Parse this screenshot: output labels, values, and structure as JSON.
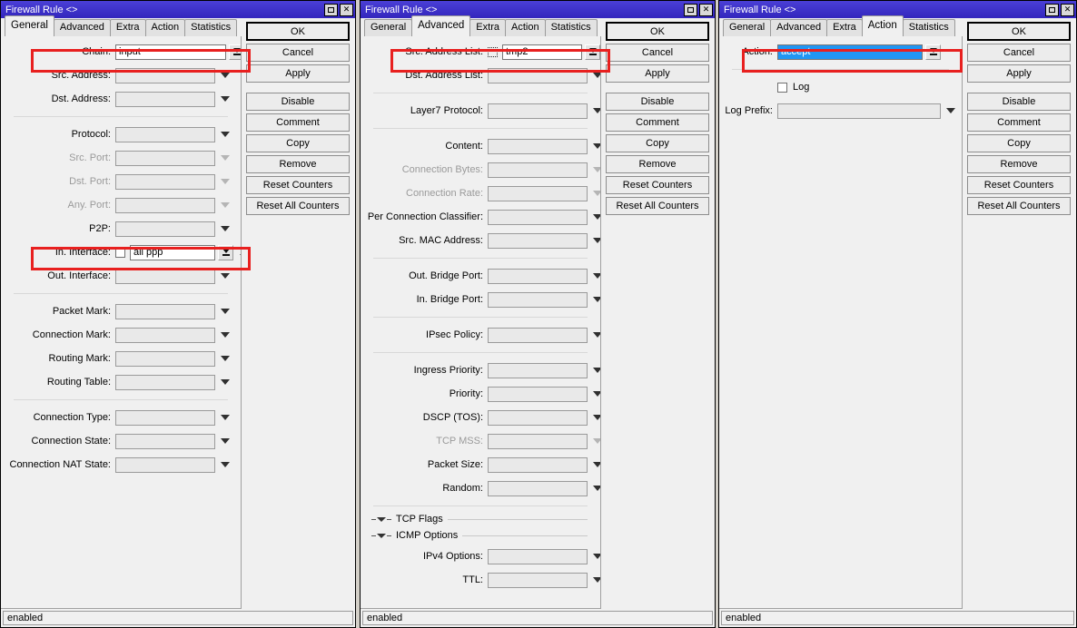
{
  "windows": [
    {
      "title": "Firewall Rule <>",
      "active_tab": "General",
      "tabs": [
        "General",
        "Advanced",
        "Extra",
        "Action",
        "Statistics"
      ],
      "status": "enabled",
      "titlebar_buttons": {
        "maximize": "maximize-icon",
        "close": "✕"
      },
      "rows": [
        {
          "label": "Chain:",
          "value": "input",
          "kind": "dropbtn",
          "dim": false
        },
        {
          "label": "Src. Address:",
          "value": "",
          "kind": "caret",
          "dim": false
        },
        {
          "label": "Dst. Address:",
          "value": "",
          "kind": "caret",
          "dim": false
        },
        {
          "label": "Protocol:",
          "value": "",
          "kind": "caret",
          "dim": false
        },
        {
          "label": "Src. Port:",
          "value": "",
          "kind": "caret",
          "dim": true
        },
        {
          "label": "Dst. Port:",
          "value": "",
          "kind": "caret",
          "dim": true
        },
        {
          "label": "Any. Port:",
          "value": "",
          "kind": "caret",
          "dim": true
        },
        {
          "label": "P2P:",
          "value": "",
          "kind": "caret",
          "dim": false
        },
        {
          "label": "In. Interface:",
          "value": "all ppp",
          "kind": "cb-dropbtn-up",
          "dim": false
        },
        {
          "label": "Out. Interface:",
          "value": "",
          "kind": "caret",
          "dim": false
        },
        {
          "label": "Packet Mark:",
          "value": "",
          "kind": "caret",
          "dim": false
        },
        {
          "label": "Connection Mark:",
          "value": "",
          "kind": "caret",
          "dim": false
        },
        {
          "label": "Routing Mark:",
          "value": "",
          "kind": "caret",
          "dim": false
        },
        {
          "label": "Routing Table:",
          "value": "",
          "kind": "caret",
          "dim": false
        },
        {
          "label": "Connection Type:",
          "value": "",
          "kind": "caret",
          "dim": false
        },
        {
          "label": "Connection State:",
          "value": "",
          "kind": "caret",
          "dim": false
        },
        {
          "label": "Connection NAT State:",
          "value": "",
          "kind": "caret",
          "dim": false
        }
      ],
      "buttons": [
        "OK",
        "Cancel",
        "Apply",
        "Disable",
        "Comment",
        "Copy",
        "Remove",
        "Reset Counters",
        "Reset All Counters"
      ]
    },
    {
      "title": "Firewall Rule <>",
      "active_tab": "Advanced",
      "tabs": [
        "General",
        "Advanced",
        "Extra",
        "Action",
        "Statistics"
      ],
      "status": "enabled",
      "titlebar_buttons": {
        "maximize": "maximize-icon",
        "close": "✕"
      },
      "rows": [
        {
          "label": "Src. Address List:",
          "value": "tmp2",
          "kind": "cbdot-dropbtn-up",
          "dim": false
        },
        {
          "label": "Dst. Address List:",
          "value": "",
          "kind": "caret",
          "dim": false
        },
        {
          "label": "Layer7 Protocol:",
          "value": "",
          "kind": "caret",
          "dim": false
        },
        {
          "label": "Content:",
          "value": "",
          "kind": "caret",
          "dim": false
        },
        {
          "label": "Connection Bytes:",
          "value": "",
          "kind": "caret",
          "dim": true
        },
        {
          "label": "Connection Rate:",
          "value": "",
          "kind": "caret",
          "dim": true
        },
        {
          "label": "Per Connection Classifier:",
          "value": "",
          "kind": "caret",
          "dim": false
        },
        {
          "label": "Src. MAC Address:",
          "value": "",
          "kind": "caret",
          "dim": false
        },
        {
          "label": "Out. Bridge Port:",
          "value": "",
          "kind": "caret",
          "dim": false
        },
        {
          "label": "In. Bridge Port:",
          "value": "",
          "kind": "caret",
          "dim": false
        },
        {
          "label": "IPsec Policy:",
          "value": "",
          "kind": "caret",
          "dim": false
        },
        {
          "label": "Ingress Priority:",
          "value": "",
          "kind": "caret",
          "dim": false
        },
        {
          "label": "Priority:",
          "value": "",
          "kind": "caret",
          "dim": false
        },
        {
          "label": "DSCP (TOS):",
          "value": "",
          "kind": "caret",
          "dim": false
        },
        {
          "label": "TCP MSS:",
          "value": "",
          "kind": "caret",
          "dim": true
        },
        {
          "label": "Packet Size:",
          "value": "",
          "kind": "caret",
          "dim": false
        },
        {
          "label": "Random:",
          "value": "",
          "kind": "caret",
          "dim": false
        },
        {
          "label": "IPv4 Options:",
          "value": "",
          "kind": "caret",
          "dim": false
        },
        {
          "label": "TTL:",
          "value": "",
          "kind": "caret",
          "dim": false
        }
      ],
      "sections": [
        "TCP Flags",
        "ICMP Options"
      ],
      "buttons": [
        "OK",
        "Cancel",
        "Apply",
        "Disable",
        "Comment",
        "Copy",
        "Remove",
        "Reset Counters",
        "Reset All Counters"
      ]
    },
    {
      "title": "Firewall Rule <>",
      "active_tab": "Action",
      "tabs": [
        "General",
        "Advanced",
        "Extra",
        "Action",
        "Statistics"
      ],
      "status": "enabled",
      "titlebar_buttons": {
        "maximize": "maximize-icon",
        "close": "✕"
      },
      "rows": [
        {
          "label": "Action:",
          "value": "accept",
          "kind": "dropbtn-selected",
          "dim": false
        },
        {
          "label": "Log",
          "value": "",
          "kind": "checkbox-label",
          "dim": false
        },
        {
          "label": "Log Prefix:",
          "value": "",
          "kind": "caret-wide",
          "dim": false
        }
      ],
      "buttons": [
        "OK",
        "Cancel",
        "Apply",
        "Disable",
        "Comment",
        "Copy",
        "Remove",
        "Reset Counters",
        "Reset All Counters"
      ]
    }
  ],
  "colors": {
    "titlebar": "#3b30c8",
    "highlight_box": "#e8201f",
    "selection": "#2196f3",
    "window_face": "#f0f0f0",
    "field_disabled": "#e9e9e9"
  }
}
